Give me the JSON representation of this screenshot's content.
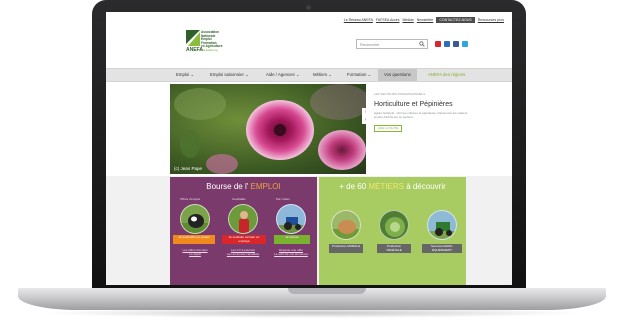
{
  "top_links": [
    "Le Réseau ANEFA",
    "FAFSEA Accès",
    "Médias",
    "Newsletter",
    "CONTACTEZ-NOUS",
    "Ressources pros"
  ],
  "logo": {
    "lines": [
      "Association",
      "Nationale",
      "Emploi",
      "Formation",
      "en Agriculture"
    ],
    "acronym": "ANEFA",
    "url": "www.anefa.org"
  },
  "search": {
    "placeholder": "Recherche"
  },
  "socials": [
    {
      "name": "youtube-icon",
      "color": "#d8262b"
    },
    {
      "name": "linkedin-icon",
      "color": "#2a6ebd"
    },
    {
      "name": "facebook-icon",
      "color": "#3b5998"
    },
    {
      "name": "twitter-icon",
      "color": "#2ca7e0"
    }
  ],
  "nav": [
    "Emploi ⌄",
    "Emploi saisonnier ⌄",
    "Aide / Agences ⌄",
    "Métiers ⌄",
    "Formation ⌄",
    "Vos questions",
    "ANEFA des régions"
  ],
  "hero": {
    "credit": "(c) Jean Pape",
    "kicker": "LES SECTEURS PROFESSIONNELS",
    "title": "Horticulture et Pépinières",
    "desc": "Agréé horticole : Voir les cultures et pépinières. Découvrez les métiers et plus d'écrits sur ce secteur...",
    "button": "LIRE LA SUITE",
    "arrow_up": "‹",
    "arrow_down": "›"
  },
  "emploi": {
    "title_a": "Bourse de l'",
    "title_b": "EMPLOI",
    "col1_sub": "Offres d'emploi",
    "col2_sub": "Candidats",
    "col3_sub": "Par métier",
    "tag1": "Je recherche un emploi",
    "tag2": "Je souhaite recruter un employé",
    "tag3": "Je recrute",
    "links1": [
      "Les offres d'emploi",
      "Le dépôt"
    ],
    "links2": [
      "Les CV à pourvoir",
      "Les annonces candidats"
    ],
    "links3": [
      "Déposer une offre",
      "Le suivi de vos annonces"
    ]
  },
  "metiers": {
    "title_a": "+ de 60",
    "title_b": "MÉTIERS",
    "title_c": "à découvrir",
    "tag1": "Production ANIMALE",
    "tag2": "Production VÉGÉTALE",
    "tag3": "Services AGRO-ÉQUIPEMENT"
  },
  "colors": {
    "emploi_bg": "#7a3b6c",
    "metiers_bg": "#a9cc62",
    "accent_green": "#8ab63c"
  }
}
